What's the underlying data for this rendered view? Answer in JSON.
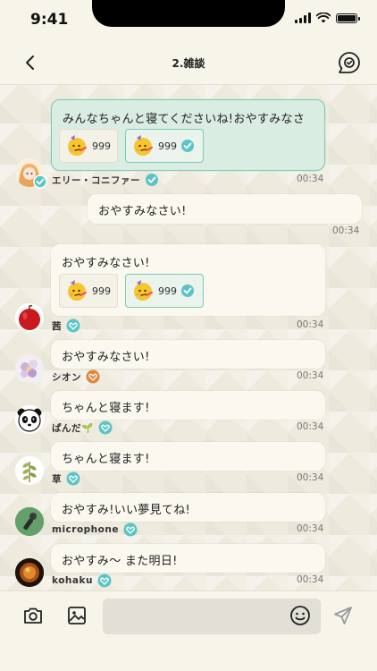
{
  "status": {
    "time": "9:41"
  },
  "header": {
    "title": "2.雑談"
  },
  "messages": [
    {
      "text": "みんなちゃんと寝てくださいね!おやすみなさい!",
      "name": "エリー・コニファー",
      "time": "00:34",
      "reactions": [
        "999",
        "999"
      ]
    },
    {
      "text": "おやすみなさい!",
      "time": "00:34"
    },
    {
      "text": "おやすみなさい!",
      "name": "茜",
      "time": "00:34",
      "reactions": [
        "999",
        "999"
      ]
    },
    {
      "text": "おやすみなさい!",
      "name": "シオン",
      "time": "00:34"
    },
    {
      "text": "ちゃんと寝ます!",
      "name": "ぱんだ🌱",
      "time": "00:34"
    },
    {
      "text": "ちゃんと寝ます!",
      "name": "草",
      "time": "00:34"
    },
    {
      "text": "おやすみ!いい夢見てね!",
      "name": "microphone",
      "time": "00:34"
    },
    {
      "text": "おやすみ〜 また明日!",
      "name": "kohaku",
      "time": "00:34"
    }
  ],
  "composer": {
    "placeholder": ""
  },
  "colors": {
    "accent": "#5cc4c6",
    "highlight": "#d9ede2",
    "orange_badge": "#e2843a"
  }
}
